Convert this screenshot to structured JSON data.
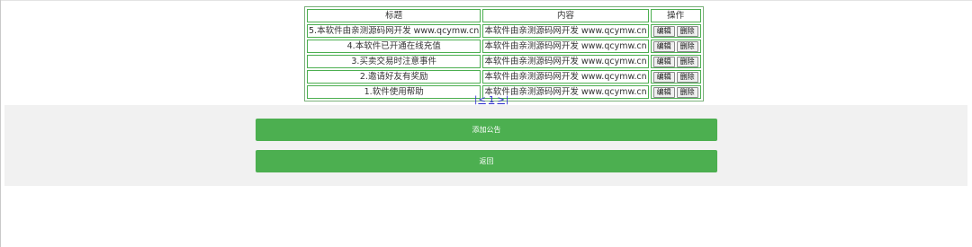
{
  "table": {
    "headers": {
      "title": "标题",
      "content": "内容",
      "actions": "操作"
    },
    "rows": [
      {
        "title": "5.本软件由亲测源码网开发 www.qcymw.cn",
        "content": "本软件由亲测源码网开发 www.qcymw.cn",
        "edit": "编辑",
        "delete": "删除"
      },
      {
        "title": "4.本软件已开通在线充值",
        "content": "本软件由亲测源码网开发 www.qcymw.cn",
        "edit": "编辑",
        "delete": "删除"
      },
      {
        "title": "3.买卖交易时注意事件",
        "content": "本软件由亲测源码网开发 www.qcymw.cn",
        "edit": "编辑",
        "delete": "删除"
      },
      {
        "title": "2.邀请好友有奖励",
        "content": "本软件由亲测源码网开发 www.qcymw.cn",
        "edit": "编辑",
        "delete": "删除"
      },
      {
        "title": "1.软件使用帮助",
        "content": "本软件由亲测源码网开发 www.qcymw.cn",
        "edit": "编辑",
        "delete": "删除"
      }
    ]
  },
  "pagination": {
    "open": "|",
    "prev": "<",
    "page": "1",
    "next": ">",
    "close": "|"
  },
  "actions": {
    "add_label": "添加公告",
    "back_label": "返回"
  },
  "colors": {
    "accent": "#4caf50",
    "panel_bg": "#f1f1f1",
    "link": "#2a2ad0"
  }
}
